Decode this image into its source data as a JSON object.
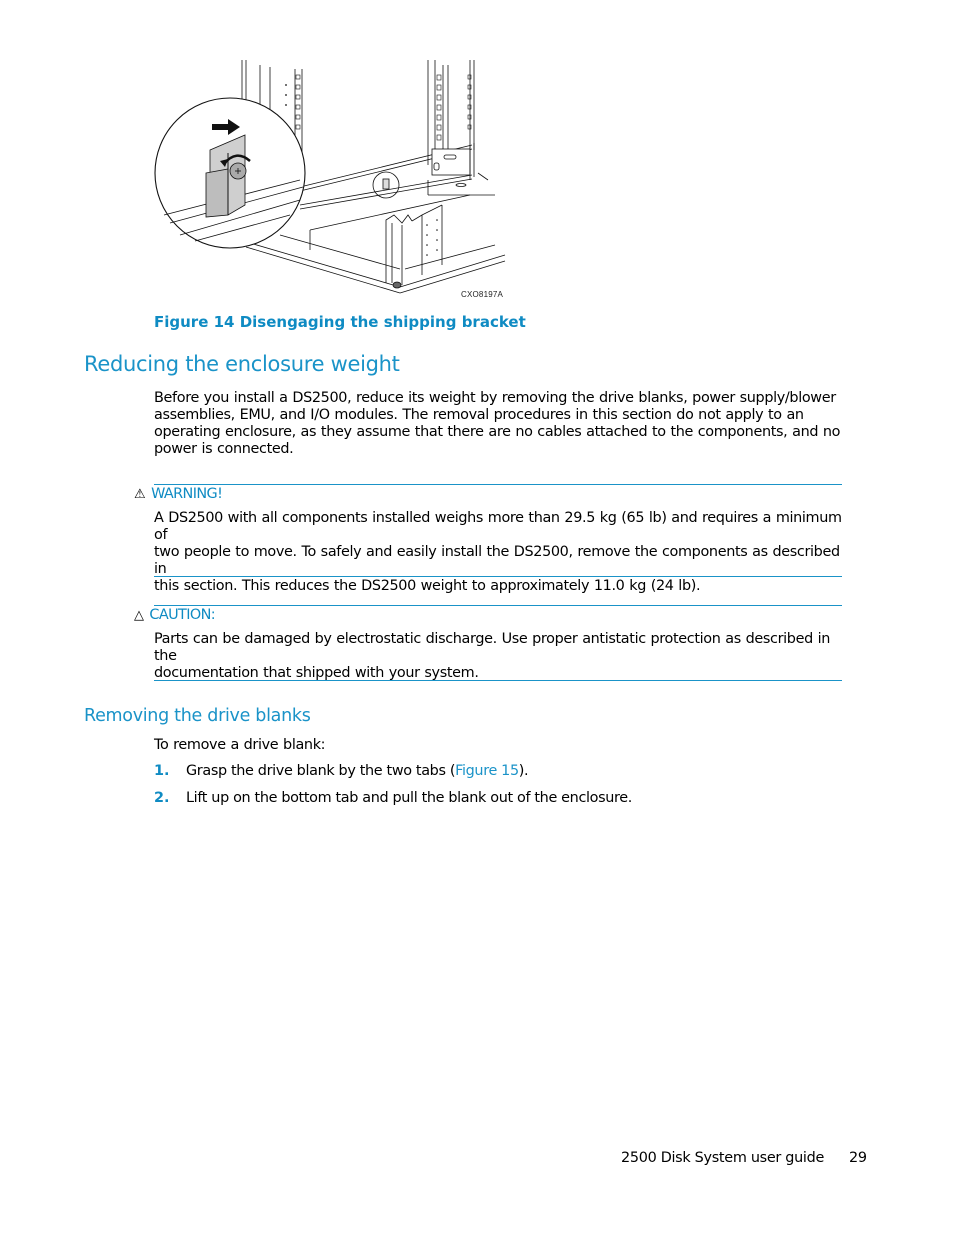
{
  "figure": {
    "id_label": "CXO8197A",
    "caption": "Figure 14 Disengaging the shipping bracket",
    "icons": [
      "magnified-bracket-callout",
      "push-arrow",
      "rotate-arrow",
      "thumbscrew",
      "rack-rail",
      "shipping-bracket"
    ]
  },
  "section": {
    "title": "Reducing the enclosure weight",
    "intro_lines": [
      "Before you install a DS2500, reduce its weight by removing the drive blanks, power supply/blower",
      "assemblies, EMU, and I/O modules.  The removal procedures in this section do not apply to an",
      "operating enclosure, as they assume that there are no cables attached to the components, and no",
      "power is connected."
    ]
  },
  "warning": {
    "icon": "warning-triangle-icon",
    "label": "WARNING!",
    "lines": [
      "A DS2500 with all components installed weighs more than 29.5 kg (65 lb) and requires a minimum of",
      "two people to move. To safely and easily install the DS2500, remove the components as described in",
      "this section.  This reduces the DS2500 weight to approximately 11.0 kg (24 lb)."
    ]
  },
  "caution": {
    "icon": "caution-triangle-icon",
    "label": "CAUTION:",
    "lines": [
      "Parts can be damaged by electrostatic discharge.  Use proper antistatic protection as described in the",
      "documentation that shipped with your system."
    ]
  },
  "subsection": {
    "title": "Removing the drive blanks",
    "intro": "To remove a drive blank:",
    "steps": [
      {
        "num": "1.",
        "before": "Grasp the drive blank by the two tabs (",
        "link": "Figure 15",
        "after": ")."
      },
      {
        "num": "2.",
        "before": "Lift up on the bottom tab and pull the blank out of the enclosure.",
        "link": "",
        "after": ""
      }
    ]
  },
  "footer": {
    "doc_title": "2500 Disk System user guide",
    "page_number": "29"
  },
  "colors": {
    "accent": "#1a93c8",
    "caption": "#0f8bc3"
  }
}
